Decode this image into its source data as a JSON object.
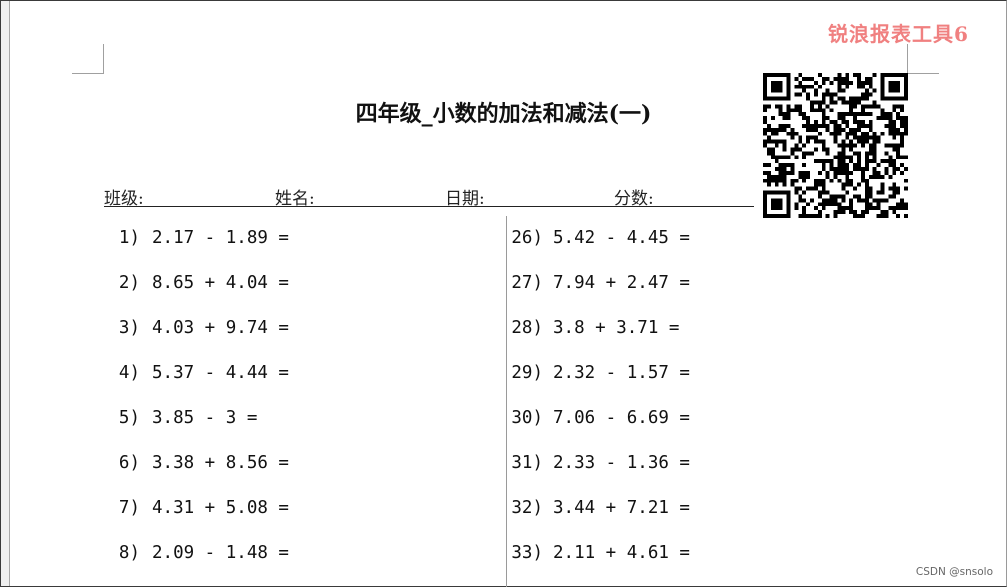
{
  "watermark": "锐浪报表工具6",
  "title": "四年级_小数的加法和减法(一)",
  "header": {
    "class_label": "班级:",
    "name_label": "姓名:",
    "date_label": "日期:",
    "score_label": "分数:"
  },
  "left_column": [
    {
      "num": "1)",
      "expr": "2.17 - 1.89 ="
    },
    {
      "num": "2)",
      "expr": "8.65 + 4.04 ="
    },
    {
      "num": "3)",
      "expr": "4.03 + 9.74 ="
    },
    {
      "num": "4)",
      "expr": "5.37 - 4.44 ="
    },
    {
      "num": "5)",
      "expr": "3.85 - 3 ="
    },
    {
      "num": "6)",
      "expr": "3.38 + 8.56 ="
    },
    {
      "num": "7)",
      "expr": "4.31 + 5.08 ="
    },
    {
      "num": "8)",
      "expr": "2.09 - 1.48 ="
    }
  ],
  "right_column": [
    {
      "num": "26)",
      "expr": "5.42 - 4.45 ="
    },
    {
      "num": "27)",
      "expr": "7.94 + 2.47 ="
    },
    {
      "num": "28)",
      "expr": "3.8 + 3.71 ="
    },
    {
      "num": "29)",
      "expr": "2.32 - 1.57 ="
    },
    {
      "num": "30)",
      "expr": "7.06 - 6.69 ="
    },
    {
      "num": "31)",
      "expr": "2.33 - 1.36 ="
    },
    {
      "num": "32)",
      "expr": "3.44 + 7.21 ="
    },
    {
      "num": "33)",
      "expr": "2.11 + 4.61 ="
    }
  ],
  "credit": "CSDN @snsolo",
  "colors": {
    "watermark": "#f08080",
    "text": "#111111"
  },
  "icons": {
    "qr": "qr-code-icon"
  }
}
